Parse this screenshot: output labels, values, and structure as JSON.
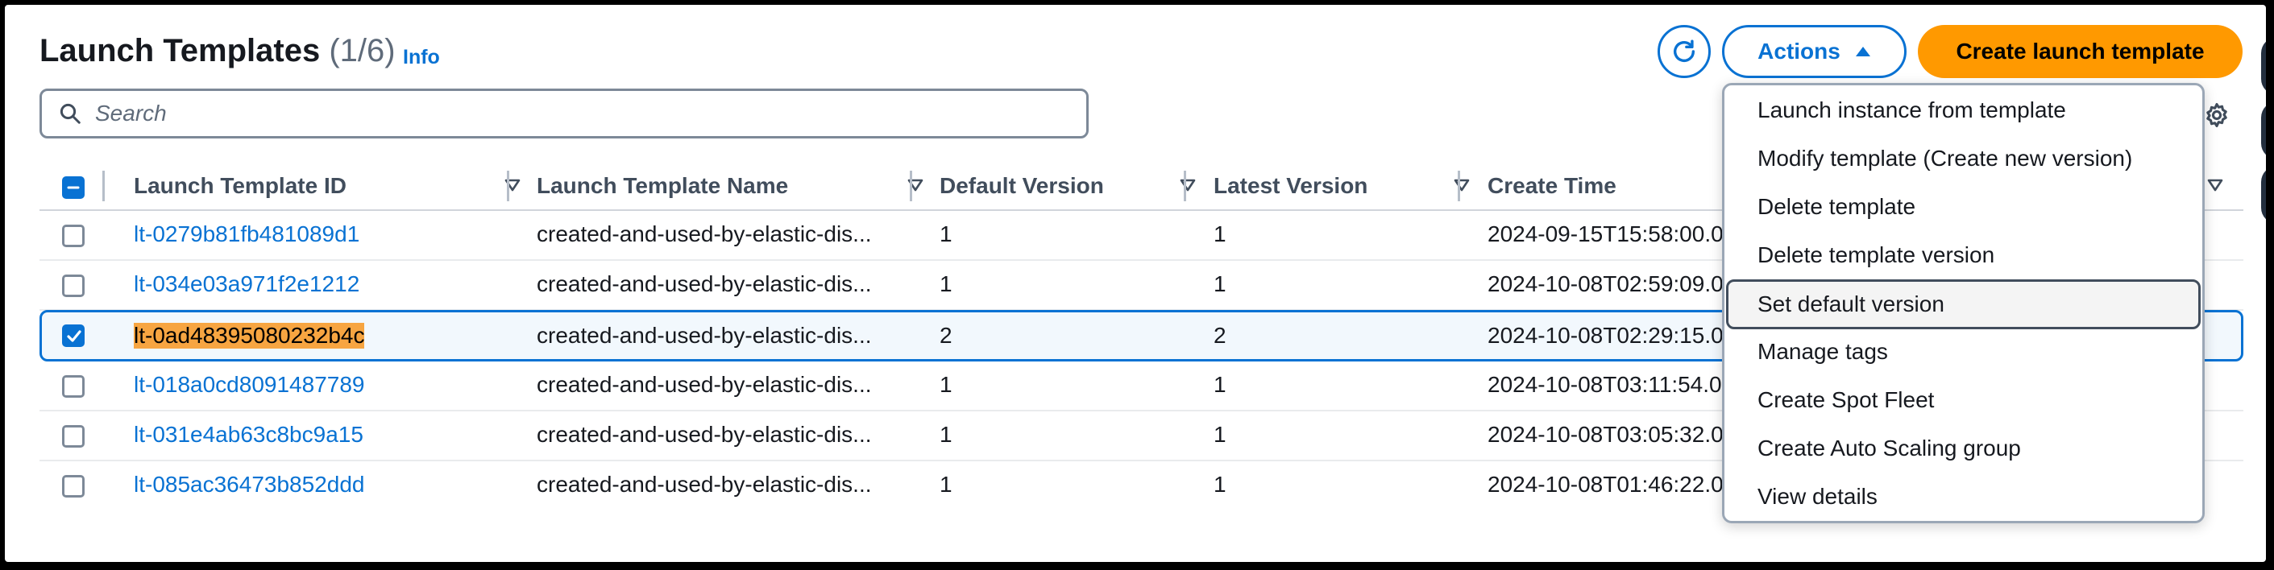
{
  "header": {
    "title": "Launch Templates",
    "count": "(1/6)",
    "info_label": "Info",
    "actions_label": "Actions",
    "create_label": "Create launch template"
  },
  "search": {
    "placeholder": "Search"
  },
  "table": {
    "columns": [
      "Launch Template ID",
      "Launch Template Name",
      "Default Version",
      "Latest Version",
      "Create Time"
    ],
    "rows": [
      {
        "id": "lt-0279b81fb481089d1",
        "name": "created-and-used-by-elastic-dis...",
        "default_version": "1",
        "latest_version": "1",
        "create_time": "2024-09-15T15:58:00.0",
        "selected": false
      },
      {
        "id": "lt-034e03a971f2e1212",
        "name": "created-and-used-by-elastic-dis...",
        "default_version": "1",
        "latest_version": "1",
        "create_time": "2024-10-08T02:59:09.0",
        "selected": false
      },
      {
        "id": "lt-0ad48395080232b4c",
        "name": "created-and-used-by-elastic-dis...",
        "default_version": "2",
        "latest_version": "2",
        "create_time": "2024-10-08T02:29:15.0",
        "selected": true
      },
      {
        "id": "lt-018a0cd8091487789",
        "name": "created-and-used-by-elastic-dis...",
        "default_version": "1",
        "latest_version": "1",
        "create_time": "2024-10-08T03:11:54.0",
        "selected": false
      },
      {
        "id": "lt-031e4ab63c8bc9a15",
        "name": "created-and-used-by-elastic-dis...",
        "default_version": "1",
        "latest_version": "1",
        "create_time": "2024-10-08T03:05:32.0",
        "selected": false
      },
      {
        "id": "lt-085ac36473b852ddd",
        "name": "created-and-used-by-elastic-dis...",
        "default_version": "1",
        "latest_version": "1",
        "create_time": "2024-10-08T01:46:22.0",
        "selected": false
      }
    ]
  },
  "actions_menu": {
    "items": [
      "Launch instance from template",
      "Modify template (Create new version)",
      "Delete template",
      "Delete template version",
      "Set default version",
      "Manage tags",
      "Create Spot Fleet",
      "Create Auto Scaling group",
      "View details"
    ],
    "active_item": "Set default version"
  },
  "colors": {
    "link": "#0972d3",
    "primary_button": "#ff9900",
    "selected_row_bg": "#f2f8fd",
    "text_highlight": "#f7a541"
  },
  "icons": [
    "search-icon",
    "refresh-icon",
    "caret-up-icon",
    "settings-icon",
    "sort-icon",
    "checkbox-icon"
  ]
}
